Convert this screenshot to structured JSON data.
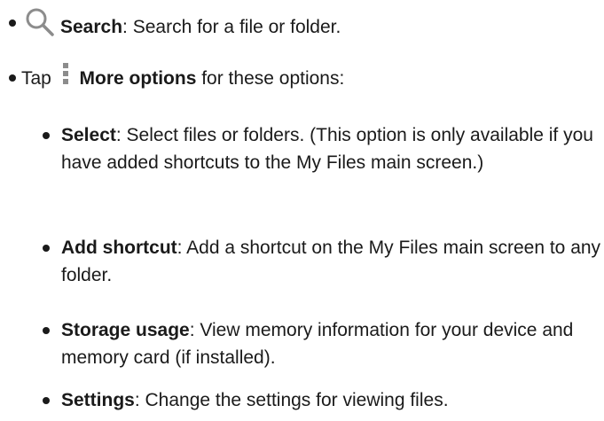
{
  "items": [
    {
      "title": "Search",
      "icon": "search-icon",
      "rest": ": Search for a file or folder."
    },
    {
      "prefix": "Tap",
      "icon": "more-options-icon",
      "title": "More options",
      "rest": "for these options:"
    }
  ],
  "subitems": [
    {
      "title": "Select",
      "rest": ": Select files or folders. (This option is only available if you have added shortcuts to the My Files main screen.)"
    },
    {
      "title": "Add shortcut",
      "rest": ": Add a shortcut on the My Files main screen to any folder."
    },
    {
      "title": "Storage usage",
      "rest": ": View memory information for your device and memory card (if installed)."
    },
    {
      "title": "Settings",
      "rest": ": Change the settings for viewing files."
    }
  ]
}
